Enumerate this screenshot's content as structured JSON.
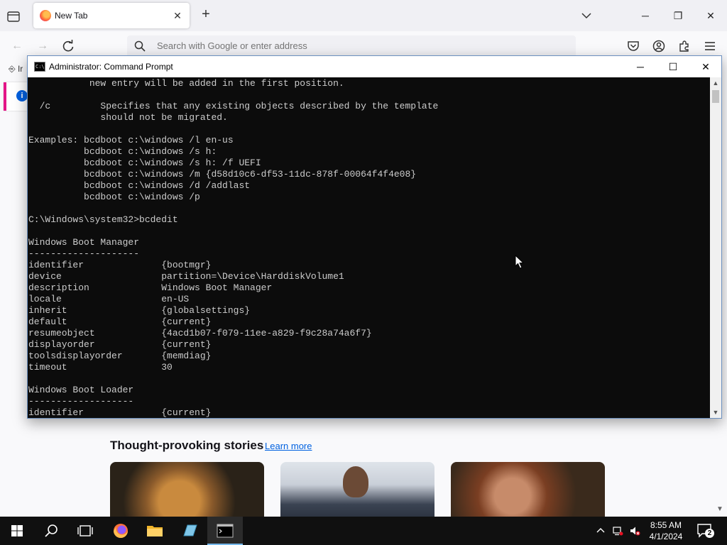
{
  "browser": {
    "tab": {
      "title": "New Tab"
    },
    "urlbar": {
      "placeholder": "Search with Google or enter address"
    },
    "sidebar_fragment": "Ir",
    "stories": {
      "title": "Thought-provoking stories",
      "learn_more": "Learn more"
    }
  },
  "cmd": {
    "title": "Administrator: Command Prompt",
    "lines": [
      "           new entry will be added in the first position.",
      "",
      "  /c         Specifies that any existing objects described by the template",
      "             should not be migrated.",
      "",
      "Examples: bcdboot c:\\windows /l en-us",
      "          bcdboot c:\\windows /s h:",
      "          bcdboot c:\\windows /s h: /f UEFI",
      "          bcdboot c:\\windows /m {d58d10c6-df53-11dc-878f-00064f4f4e08}",
      "          bcdboot c:\\windows /d /addlast",
      "          bcdboot c:\\windows /p",
      "",
      "C:\\Windows\\system32>bcdedit",
      "",
      "Windows Boot Manager",
      "--------------------",
      "identifier              {bootmgr}",
      "device                  partition=\\Device\\HarddiskVolume1",
      "description             Windows Boot Manager",
      "locale                  en-US",
      "inherit                 {globalsettings}",
      "default                 {current}",
      "resumeobject            {4acd1b07-f079-11ee-a829-f9c28a74a6f7}",
      "displayorder            {current}",
      "toolsdisplayorder       {memdiag}",
      "timeout                 30",
      "",
      "Windows Boot Loader",
      "-------------------",
      "identifier              {current}"
    ]
  },
  "taskbar": {
    "time": "8:55 AM",
    "date": "4/1/2024",
    "notification_count": "2"
  },
  "colors": {
    "console_bg": "#0c0c0c",
    "console_fg": "#cccccc",
    "taskbar_bg": "#101010",
    "accent": "#0061e0"
  }
}
